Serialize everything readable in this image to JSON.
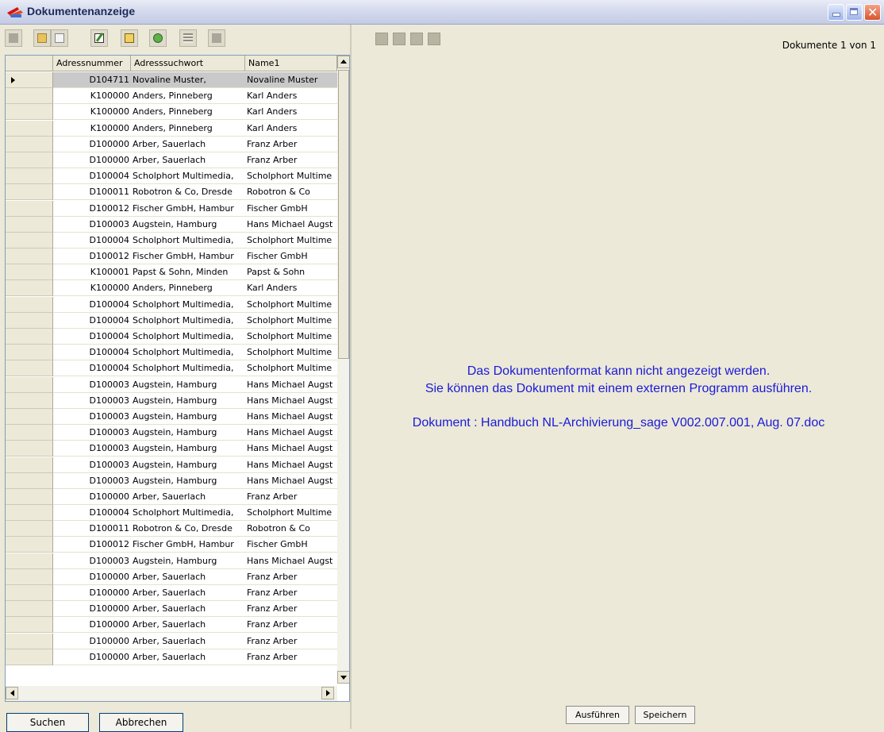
{
  "window": {
    "title": "Dokumentenanzeige"
  },
  "table": {
    "columns": [
      "Adressnummer",
      "Adresssuchwort",
      "Name1"
    ],
    "rows": [
      [
        "D104711",
        "Novaline Muster,",
        "Novaline Muster"
      ],
      [
        "K100000",
        "Anders, Pinneberg",
        "Karl Anders"
      ],
      [
        "K100000",
        "Anders, Pinneberg",
        "Karl Anders"
      ],
      [
        "K100000",
        "Anders, Pinneberg",
        "Karl Anders"
      ],
      [
        "D100000",
        "Arber, Sauerlach",
        "Franz Arber"
      ],
      [
        "D100000",
        "Arber, Sauerlach",
        "Franz Arber"
      ],
      [
        "D100004",
        "Scholphort Multimedia,",
        "Scholphort Multime"
      ],
      [
        "D100011",
        "Robotron & Co, Dresde",
        "Robotron & Co"
      ],
      [
        "D100012",
        "Fischer GmbH, Hambur",
        "Fischer GmbH"
      ],
      [
        "D100003",
        "Augstein, Hamburg",
        "Hans Michael Augst"
      ],
      [
        "D100004",
        "Scholphort Multimedia,",
        "Scholphort Multime"
      ],
      [
        "D100012",
        "Fischer GmbH, Hambur",
        "Fischer GmbH"
      ],
      [
        "K100001",
        "Papst & Sohn, Minden",
        "Papst & Sohn"
      ],
      [
        "K100000",
        "Anders, Pinneberg",
        "Karl Anders"
      ],
      [
        "D100004",
        "Scholphort Multimedia,",
        "Scholphort Multime"
      ],
      [
        "D100004",
        "Scholphort Multimedia,",
        "Scholphort Multime"
      ],
      [
        "D100004",
        "Scholphort Multimedia,",
        "Scholphort Multime"
      ],
      [
        "D100004",
        "Scholphort Multimedia,",
        "Scholphort Multime"
      ],
      [
        "D100004",
        "Scholphort Multimedia,",
        "Scholphort Multime"
      ],
      [
        "D100003",
        "Augstein, Hamburg",
        "Hans Michael Augst"
      ],
      [
        "D100003",
        "Augstein, Hamburg",
        "Hans Michael Augst"
      ],
      [
        "D100003",
        "Augstein, Hamburg",
        "Hans Michael Augst"
      ],
      [
        "D100003",
        "Augstein, Hamburg",
        "Hans Michael Augst"
      ],
      [
        "D100003",
        "Augstein, Hamburg",
        "Hans Michael Augst"
      ],
      [
        "D100003",
        "Augstein, Hamburg",
        "Hans Michael Augst"
      ],
      [
        "D100003",
        "Augstein, Hamburg",
        "Hans Michael Augst"
      ],
      [
        "D100000",
        "Arber, Sauerlach",
        "Franz Arber"
      ],
      [
        "D100004",
        "Scholphort Multimedia,",
        "Scholphort Multime"
      ],
      [
        "D100011",
        "Robotron & Co, Dresde",
        "Robotron & Co"
      ],
      [
        "D100012",
        "Fischer GmbH, Hambur",
        "Fischer GmbH"
      ],
      [
        "D100003",
        "Augstein, Hamburg",
        "Hans Michael Augst"
      ],
      [
        "D100000",
        "Arber, Sauerlach",
        "Franz Arber"
      ],
      [
        "D100000",
        "Arber, Sauerlach",
        "Franz Arber"
      ],
      [
        "D100000",
        "Arber, Sauerlach",
        "Franz Arber"
      ],
      [
        "D100000",
        "Arber, Sauerlach",
        "Franz Arber"
      ],
      [
        "D100000",
        "Arber, Sauerlach",
        "Franz Arber"
      ],
      [
        "D100000",
        "Arber, Sauerlach",
        "Franz Arber"
      ]
    ],
    "selected_index": 0
  },
  "left_buttons": {
    "search": "Suchen",
    "cancel": "Abbrechen"
  },
  "viewer": {
    "doc_count": "Dokumente 1 von 1",
    "message_line1": "Das Dokumentenformat kann nicht angezeigt werden.",
    "message_line2": "Sie können das Dokument mit einem externen Programm ausführen.",
    "document_line": "Dokument : Handbuch NL-Archivierung_sage V002.007.001, Aug. 07.doc",
    "execute_label": "Ausführen",
    "save_label": "Speichern",
    "message_color": "#1a1ad8"
  },
  "icons": {
    "toolbar": [
      "toolbar-disabled-icon",
      "folder-open-icon",
      "checkbox-icon",
      "edit-icon",
      "tree-icon",
      "refresh-icon",
      "list-icon",
      "export-icon"
    ],
    "nav": [
      "first-page-icon",
      "prev-page-icon",
      "next-page-icon",
      "last-page-icon"
    ]
  }
}
